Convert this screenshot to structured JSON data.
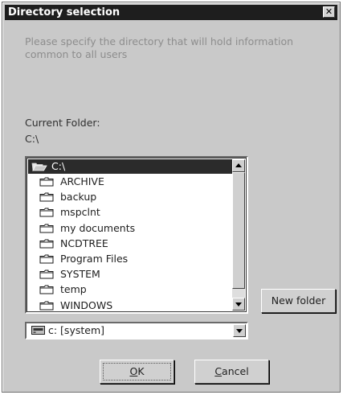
{
  "window": {
    "title": "Directory selection"
  },
  "prompt": "Please specify the directory that will hold  information common to all users",
  "current_folder": {
    "label": "Current Folder:",
    "value": "C:\\"
  },
  "tree": {
    "root": "C:\\",
    "folders": [
      "ARCHIVE",
      "backup",
      "mspclnt",
      "my documents",
      "NCDTREE",
      "Program Files",
      "SYSTEM",
      "temp",
      "WINDOWS"
    ]
  },
  "drive": {
    "selected": "c: [system]"
  },
  "buttons": {
    "new_folder": "New folder",
    "ok_accel": "O",
    "ok_rest": "K",
    "cancel_accel": "C",
    "cancel_rest": "ancel"
  }
}
